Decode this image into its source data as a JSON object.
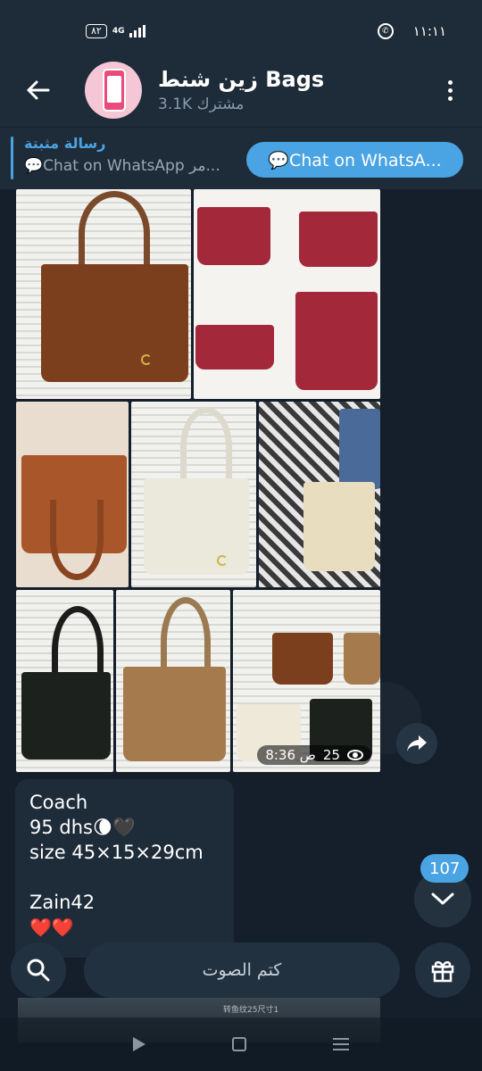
{
  "status_bar": {
    "battery": "٨٢",
    "network": "4G",
    "time": "١١:١١"
  },
  "header": {
    "title": "زين شنط Bags",
    "subscribers": "3.1K مشترك"
  },
  "pinned": {
    "label": "رسالة مثبتة",
    "message": "💬Chat on WhatsApp مر...",
    "button_label": "💬Chat on WhatsA..."
  },
  "album": {
    "views": "25",
    "time": "8:36 ص"
  },
  "message": {
    "lines": [
      "Coach",
      "95 dhs🌘🖤",
      "size 45×15×29cm",
      "",
      "Zain42"
    ],
    "hearts": "❤️❤️"
  },
  "unread_count": "107",
  "bottom_bar": {
    "mute_label": "كتم الصوت"
  },
  "next_preview_text": "转鱼纹25尺寸1",
  "colors": {
    "accent": "#4aa3e3",
    "header_bg": "#1e2b38",
    "chat_bg": "#141f2b"
  },
  "icons": [
    "back-arrow-icon",
    "more-vert-icon",
    "eye-icon",
    "share-icon",
    "chevron-down-icon",
    "search-icon",
    "gift-icon",
    "whatsapp-icon"
  ]
}
